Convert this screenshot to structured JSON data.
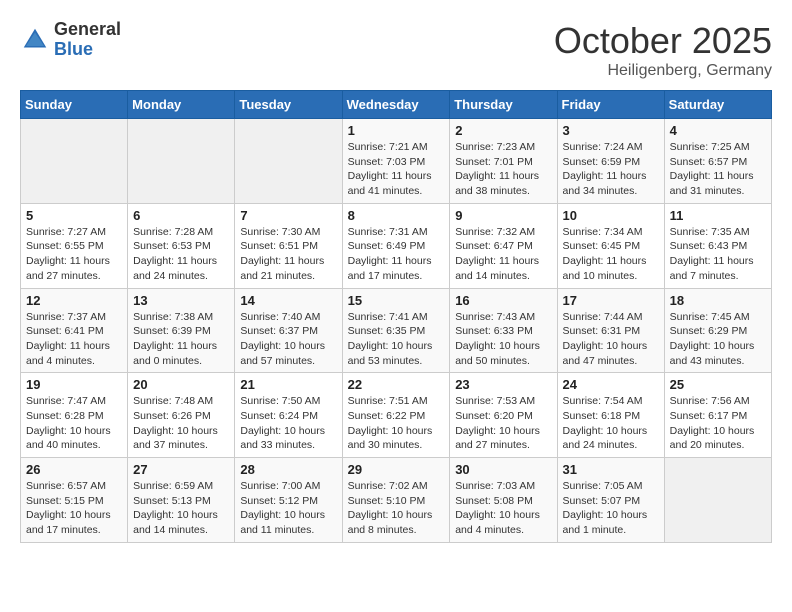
{
  "header": {
    "logo": {
      "general": "General",
      "blue": "Blue"
    },
    "title": "October 2025",
    "subtitle": "Heiligenberg, Germany"
  },
  "weekdays": [
    "Sunday",
    "Monday",
    "Tuesday",
    "Wednesday",
    "Thursday",
    "Friday",
    "Saturday"
  ],
  "weeks": [
    [
      {
        "day": "",
        "info": ""
      },
      {
        "day": "",
        "info": ""
      },
      {
        "day": "",
        "info": ""
      },
      {
        "day": "1",
        "info": "Sunrise: 7:21 AM\nSunset: 7:03 PM\nDaylight: 11 hours and 41 minutes."
      },
      {
        "day": "2",
        "info": "Sunrise: 7:23 AM\nSunset: 7:01 PM\nDaylight: 11 hours and 38 minutes."
      },
      {
        "day": "3",
        "info": "Sunrise: 7:24 AM\nSunset: 6:59 PM\nDaylight: 11 hours and 34 minutes."
      },
      {
        "day": "4",
        "info": "Sunrise: 7:25 AM\nSunset: 6:57 PM\nDaylight: 11 hours and 31 minutes."
      }
    ],
    [
      {
        "day": "5",
        "info": "Sunrise: 7:27 AM\nSunset: 6:55 PM\nDaylight: 11 hours and 27 minutes."
      },
      {
        "day": "6",
        "info": "Sunrise: 7:28 AM\nSunset: 6:53 PM\nDaylight: 11 hours and 24 minutes."
      },
      {
        "day": "7",
        "info": "Sunrise: 7:30 AM\nSunset: 6:51 PM\nDaylight: 11 hours and 21 minutes."
      },
      {
        "day": "8",
        "info": "Sunrise: 7:31 AM\nSunset: 6:49 PM\nDaylight: 11 hours and 17 minutes."
      },
      {
        "day": "9",
        "info": "Sunrise: 7:32 AM\nSunset: 6:47 PM\nDaylight: 11 hours and 14 minutes."
      },
      {
        "day": "10",
        "info": "Sunrise: 7:34 AM\nSunset: 6:45 PM\nDaylight: 11 hours and 10 minutes."
      },
      {
        "day": "11",
        "info": "Sunrise: 7:35 AM\nSunset: 6:43 PM\nDaylight: 11 hours and 7 minutes."
      }
    ],
    [
      {
        "day": "12",
        "info": "Sunrise: 7:37 AM\nSunset: 6:41 PM\nDaylight: 11 hours and 4 minutes."
      },
      {
        "day": "13",
        "info": "Sunrise: 7:38 AM\nSunset: 6:39 PM\nDaylight: 11 hours and 0 minutes."
      },
      {
        "day": "14",
        "info": "Sunrise: 7:40 AM\nSunset: 6:37 PM\nDaylight: 10 hours and 57 minutes."
      },
      {
        "day": "15",
        "info": "Sunrise: 7:41 AM\nSunset: 6:35 PM\nDaylight: 10 hours and 53 minutes."
      },
      {
        "day": "16",
        "info": "Sunrise: 7:43 AM\nSunset: 6:33 PM\nDaylight: 10 hours and 50 minutes."
      },
      {
        "day": "17",
        "info": "Sunrise: 7:44 AM\nSunset: 6:31 PM\nDaylight: 10 hours and 47 minutes."
      },
      {
        "day": "18",
        "info": "Sunrise: 7:45 AM\nSunset: 6:29 PM\nDaylight: 10 hours and 43 minutes."
      }
    ],
    [
      {
        "day": "19",
        "info": "Sunrise: 7:47 AM\nSunset: 6:28 PM\nDaylight: 10 hours and 40 minutes."
      },
      {
        "day": "20",
        "info": "Sunrise: 7:48 AM\nSunset: 6:26 PM\nDaylight: 10 hours and 37 minutes."
      },
      {
        "day": "21",
        "info": "Sunrise: 7:50 AM\nSunset: 6:24 PM\nDaylight: 10 hours and 33 minutes."
      },
      {
        "day": "22",
        "info": "Sunrise: 7:51 AM\nSunset: 6:22 PM\nDaylight: 10 hours and 30 minutes."
      },
      {
        "day": "23",
        "info": "Sunrise: 7:53 AM\nSunset: 6:20 PM\nDaylight: 10 hours and 27 minutes."
      },
      {
        "day": "24",
        "info": "Sunrise: 7:54 AM\nSunset: 6:18 PM\nDaylight: 10 hours and 24 minutes."
      },
      {
        "day": "25",
        "info": "Sunrise: 7:56 AM\nSunset: 6:17 PM\nDaylight: 10 hours and 20 minutes."
      }
    ],
    [
      {
        "day": "26",
        "info": "Sunrise: 6:57 AM\nSunset: 5:15 PM\nDaylight: 10 hours and 17 minutes."
      },
      {
        "day": "27",
        "info": "Sunrise: 6:59 AM\nSunset: 5:13 PM\nDaylight: 10 hours and 14 minutes."
      },
      {
        "day": "28",
        "info": "Sunrise: 7:00 AM\nSunset: 5:12 PM\nDaylight: 10 hours and 11 minutes."
      },
      {
        "day": "29",
        "info": "Sunrise: 7:02 AM\nSunset: 5:10 PM\nDaylight: 10 hours and 8 minutes."
      },
      {
        "day": "30",
        "info": "Sunrise: 7:03 AM\nSunset: 5:08 PM\nDaylight: 10 hours and 4 minutes."
      },
      {
        "day": "31",
        "info": "Sunrise: 7:05 AM\nSunset: 5:07 PM\nDaylight: 10 hours and 1 minute."
      },
      {
        "day": "",
        "info": ""
      }
    ]
  ]
}
